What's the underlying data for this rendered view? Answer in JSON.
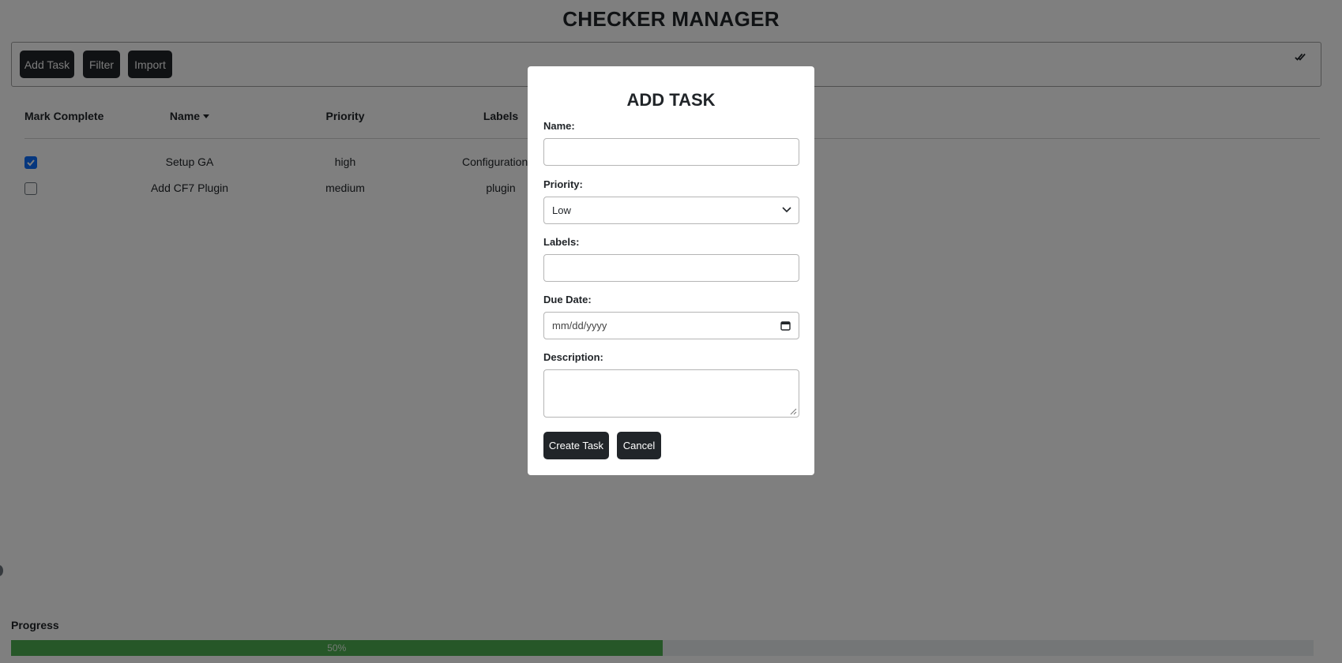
{
  "app": {
    "title": "CHECKER MANAGER"
  },
  "toolbar": {
    "add_task_label": "Add Task",
    "filter_label": "Filter",
    "import_label": "Import",
    "check_all_icon": "double-check-icon"
  },
  "table": {
    "headers": {
      "mark_complete": "Mark Complete",
      "name": "Name",
      "priority": "Priority",
      "labels": "Labels"
    },
    "sort_icon": "caret-down-icon",
    "rows": [
      {
        "completed": true,
        "name": "Setup GA",
        "priority": "high",
        "labels": "Configuration, s"
      },
      {
        "completed": false,
        "name": "Add CF7 Plugin",
        "priority": "medium",
        "labels": "plugin"
      }
    ]
  },
  "progress": {
    "label": "Progress",
    "value": 0.5,
    "text": "50%"
  },
  "modal": {
    "title": "ADD TASK",
    "name": {
      "label": "Name:",
      "value": ""
    },
    "priority": {
      "label": "Priority:",
      "value": "Low"
    },
    "labels": {
      "label": "Labels:",
      "value": ""
    },
    "due_date": {
      "label": "Due Date:",
      "placeholder": "mm/dd/yyyy"
    },
    "description": {
      "label": "Description:",
      "value": ""
    },
    "create_label": "Create Task",
    "cancel_label": "Cancel"
  },
  "colors": {
    "dark_button": "#212529",
    "progress_fill": "#4caf50",
    "progress_track": "#e9ecef",
    "checkbox_checked": "#0d6efd",
    "overlay": "rgba(0,0,0,0.5)"
  }
}
